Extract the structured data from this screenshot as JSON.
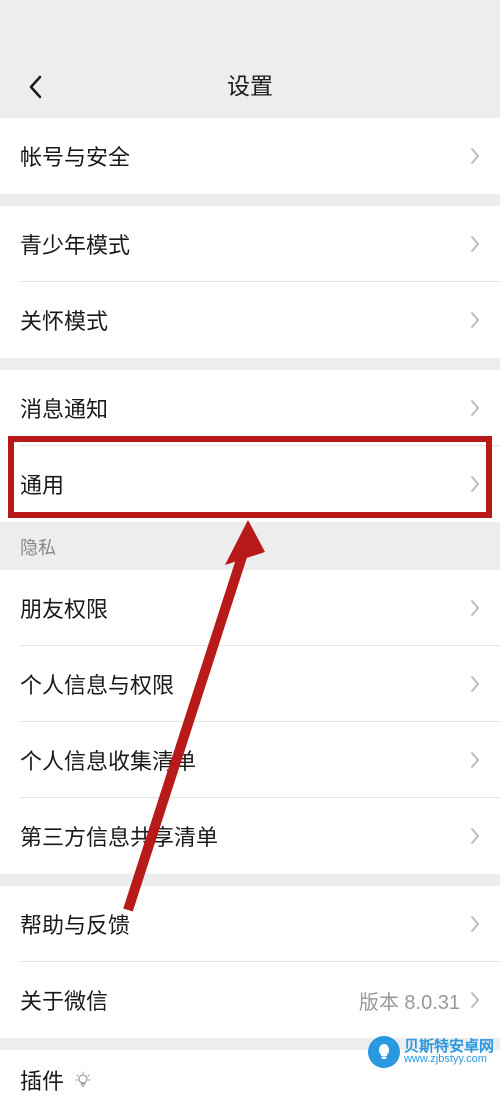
{
  "header": {
    "title": "设置"
  },
  "groups": {
    "account": {
      "label": "帐号与安全"
    },
    "mode": {
      "youth": "青少年模式",
      "care": "关怀模式"
    },
    "notification": {
      "label": "消息通知",
      "general": "通用"
    },
    "privacy": {
      "header": "隐私",
      "friends": "朋友权限",
      "personal_info": "个人信息与权限",
      "collection": "个人信息收集清单",
      "third_party": "第三方信息共享清单"
    },
    "support": {
      "help": "帮助与反馈",
      "about": "关于微信",
      "version": "版本 8.0.31"
    },
    "plugin": {
      "label": "插件"
    }
  },
  "watermark": {
    "title": "贝斯特安卓网",
    "url": "www.zjbstyy.com"
  }
}
